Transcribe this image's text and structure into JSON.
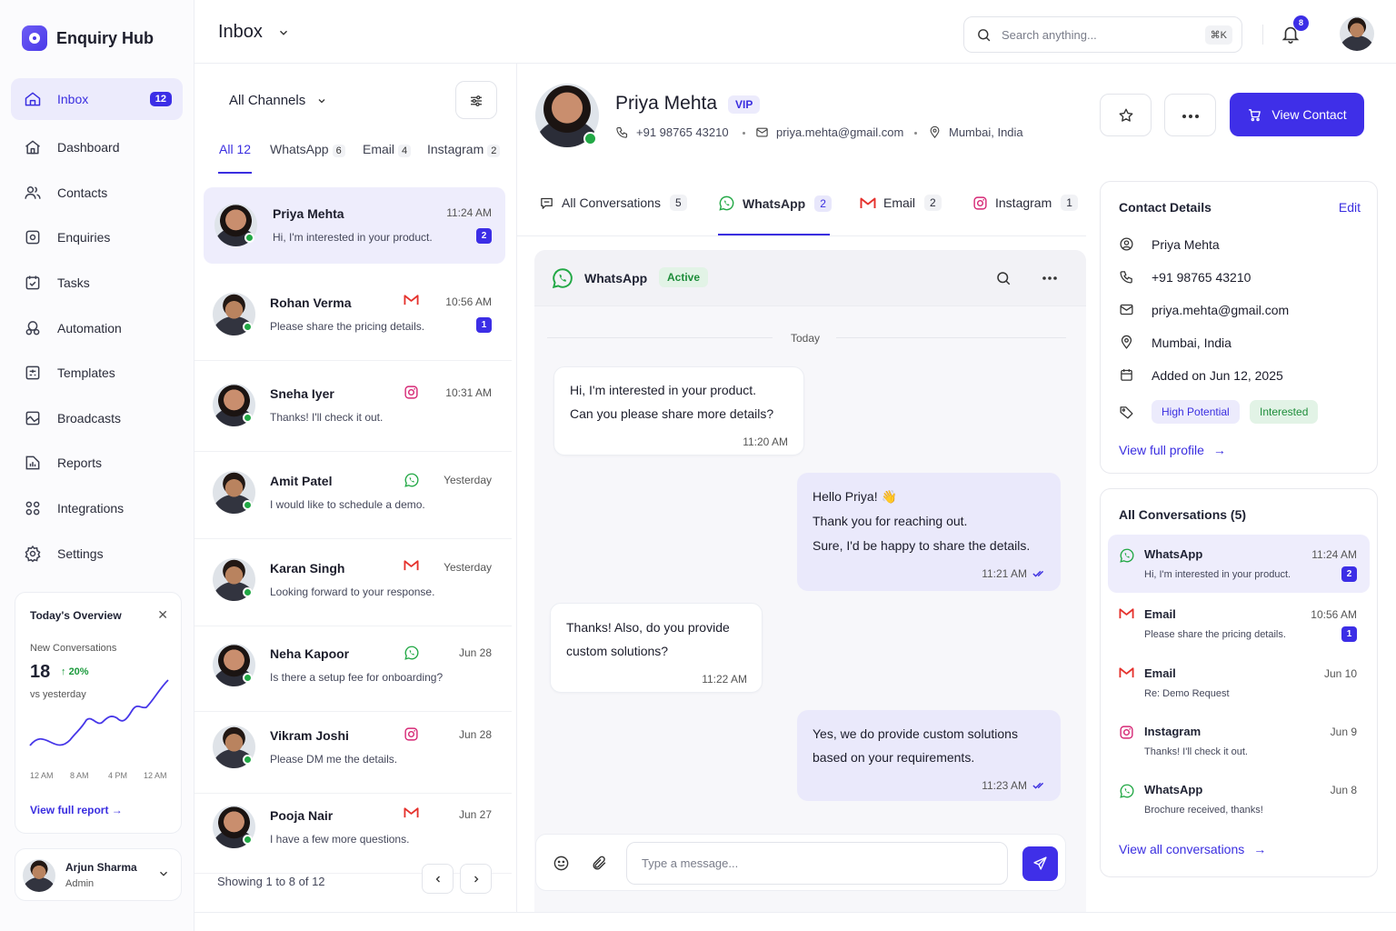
{
  "app": {
    "name": "Enquiry Hub"
  },
  "sidebar": {
    "items": [
      {
        "label": "Inbox",
        "count": "12",
        "icon": "inbox-icon"
      },
      {
        "label": "Dashboard",
        "icon": "home-icon"
      },
      {
        "label": "Contacts",
        "icon": "users-icon"
      },
      {
        "label": "Enquiries",
        "icon": "enquiry-icon"
      },
      {
        "label": "Tasks",
        "icon": "tasks-icon"
      },
      {
        "label": "Automation",
        "icon": "automation-icon"
      },
      {
        "label": "Templates",
        "icon": "templates-icon"
      },
      {
        "label": "Broadcasts",
        "icon": "broadcast-icon"
      },
      {
        "label": "Reports",
        "icon": "reports-icon"
      },
      {
        "label": "Integrations",
        "icon": "integrations-icon"
      },
      {
        "label": "Settings",
        "icon": "gear-icon"
      }
    ],
    "overview": {
      "title": "Today's Overview",
      "metric_label": "New Conversations",
      "value": "18",
      "change": "20%",
      "comparison": "vs yesterday",
      "ticks": [
        "12 AM",
        "8 AM",
        "4 PM",
        "12 AM"
      ],
      "link": "View full report"
    },
    "user": {
      "name": "Arjun Sharma",
      "role": "Admin"
    }
  },
  "header": {
    "title": "Inbox",
    "search_placeholder": "Search anything...",
    "search_shortcut": "⌘K",
    "notifications": "8"
  },
  "list": {
    "channel_filter": "All Channels",
    "tabs": [
      {
        "label": "All",
        "count": "12"
      },
      {
        "label": "WhatsApp",
        "count": "6"
      },
      {
        "label": "Email",
        "count": "4"
      },
      {
        "label": "Instagram",
        "count": "2"
      }
    ],
    "conversations": [
      {
        "name": "Priya Mehta",
        "time": "11:24 AM",
        "preview": "Hi, I'm interested in your product.",
        "unread": "2",
        "channel": "",
        "gender": "f"
      },
      {
        "name": "Rohan Verma",
        "time": "10:56 AM",
        "preview": "Please share the pricing details.",
        "unread": "1",
        "channel": "email",
        "gender": "m"
      },
      {
        "name": "Sneha Iyer",
        "time": "10:31 AM",
        "preview": "Thanks! I'll check it out.",
        "unread": "",
        "channel": "instagram",
        "gender": "f"
      },
      {
        "name": "Amit Patel",
        "time": "Yesterday",
        "preview": "I would like to schedule a demo.",
        "unread": "",
        "channel": "whatsapp",
        "gender": "m"
      },
      {
        "name": "Karan Singh",
        "time": "Yesterday",
        "preview": "Looking forward to your response.",
        "unread": "",
        "channel": "email",
        "gender": "m"
      },
      {
        "name": "Neha Kapoor",
        "time": "Jun 28",
        "preview": "Is there a setup fee for onboarding?",
        "unread": "",
        "channel": "whatsapp",
        "gender": "f"
      },
      {
        "name": "Vikram Joshi",
        "time": "Jun 28",
        "preview": "Please DM me the details.",
        "unread": "",
        "channel": "instagram",
        "gender": "m"
      },
      {
        "name": "Pooja Nair",
        "time": "Jun 27",
        "preview": "I have a few more questions.",
        "unread": "",
        "channel": "email",
        "gender": "f"
      }
    ],
    "pagination": "Showing 1 to 8 of 12"
  },
  "contact": {
    "name": "Priya Mehta",
    "badge": "VIP",
    "phone": "+91 98765 43210",
    "email": "priya.mehta@gmail.com",
    "location": "Mumbai, India",
    "view_contact_label": "View Contact",
    "tabs": [
      {
        "label": "All Conversations",
        "count": "5"
      },
      {
        "label": "WhatsApp",
        "count": "2"
      },
      {
        "label": "Email",
        "count": "2"
      },
      {
        "label": "Instagram",
        "count": "1"
      }
    ]
  },
  "chat": {
    "channel": "WhatsApp",
    "status": "Active",
    "date_divider": "Today",
    "messages": [
      {
        "dir": "in",
        "lines": [
          "Hi, I'm interested in your product.",
          "Can you please share more details?"
        ],
        "time": "11:20 AM"
      },
      {
        "dir": "out",
        "lines": [
          "Hello Priya! 👋",
          "Thank you for reaching out.",
          "Sure, I'd be happy to share the details."
        ],
        "time": "11:21 AM"
      },
      {
        "dir": "in",
        "lines": [
          "Thanks! Also, do you provide",
          "custom solutions?"
        ],
        "time": "11:22 AM"
      },
      {
        "dir": "out",
        "lines": [
          "Yes, we do provide custom solutions",
          "based on your requirements."
        ],
        "time": "11:23 AM"
      }
    ],
    "input_placeholder": "Type a message..."
  },
  "details": {
    "title": "Contact Details",
    "edit_label": "Edit",
    "name": "Priya Mehta",
    "phone": "+91 98765 43210",
    "email": "priya.mehta@gmail.com",
    "location": "Mumbai, India",
    "added": "Added on Jun 12, 2025",
    "tags": [
      "High Potential",
      "Interested"
    ],
    "profile_link": "View full profile"
  },
  "all_conversations": {
    "title": "All Conversations (5)",
    "items": [
      {
        "channel": "WhatsApp",
        "time": "11:24 AM",
        "preview": "Hi, I'm interested in your product.",
        "unread": "2",
        "type": "whatsapp"
      },
      {
        "channel": "Email",
        "time": "10:56 AM",
        "preview": "Please share the pricing details.",
        "unread": "1",
        "type": "email"
      },
      {
        "channel": "Email",
        "time": "Jun 10",
        "preview": "Re: Demo Request",
        "unread": "",
        "type": "email"
      },
      {
        "channel": "Instagram",
        "time": "Jun 9",
        "preview": "Thanks! I'll check it out.",
        "unread": "",
        "type": "instagram"
      },
      {
        "channel": "WhatsApp",
        "time": "Jun 8",
        "preview": "Brochure received, thanks!",
        "unread": "",
        "type": "whatsapp"
      }
    ],
    "link": "View all conversations"
  },
  "colors": {
    "accent": "#3f2fe8",
    "whatsapp": "#22a845",
    "email": "#e5322d",
    "instagram": "#d62976"
  }
}
